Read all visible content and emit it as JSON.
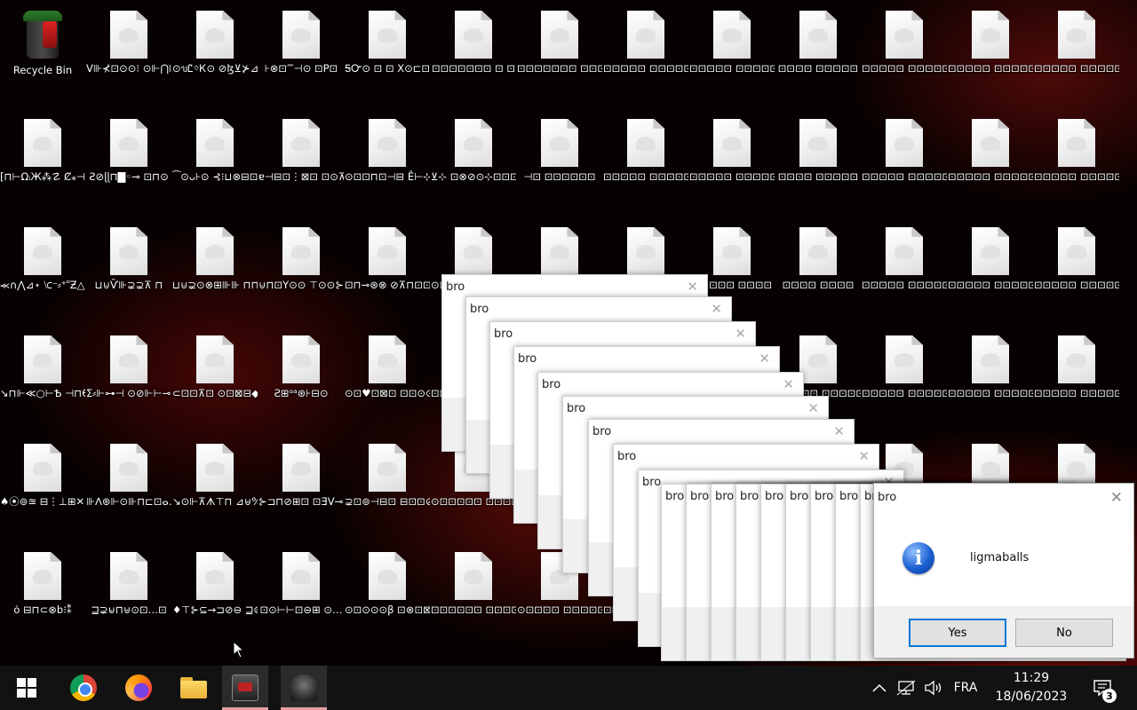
{
  "desktop": {
    "icons": [
      {
        "type": "bin",
        "label": "Recycle Bin"
      },
      {
        "label": "⁅⊓⊢ΩᵢЖ⁂☡ Ȼ⁎⊣Ϟ∤⁑∢ɱ"
      },
      {
        "label": "⪻∩⋀⊿⋆ ⟈⁻⸗⁺⸋Ƶ△ɥ"
      },
      {
        "label": "↘⊓⊩≪○⊢Ѣ ⊣⊓Ɵ⊙ϒ⊟⊘⸗"
      },
      {
        "label": "♠⦿⊚≊ ⊟⋮⊥⊞✕⊠⊷"
      },
      {
        "label": "ȯ ⊟⊓⊂⊗b⁝⁑"
      },
      {
        "label": "V⊪⊀⊡⊙⊙⁝ ⊙⊩⋂⊪⊪⋤⋒ɘ"
      },
      {
        "label": "Ƨ⊘ɭɭ⊓▇◦⊸ ⊡⊓⊙"
      },
      {
        "label": "⊔⊍Ѷ⊪⊋⊋⊼ ⊓"
      },
      {
        "label": "ⵉ⸗⊩⊶⊣ ⊙⊘⊩⊢⊸⊶⊹"
      },
      {
        "label": "⊪ᐱ⊛⊩⊙⊪⊓⊏⊡ⴰ…"
      },
      {
        "label": "⊒⊋⊌⊓⊎⊙⊡…⊡"
      },
      {
        "label": "⊙ᥔᏝᛜᏦ⊙ ⊘ɮ⊻⊁⊿⊜⊛…"
      },
      {
        "label": "⁀⊙ᴗ⊦⊙ ⊰⁝⊔⊗⊟⊡⊡ᵹ⊞"
      },
      {
        "label": "⊔⊍⊋⊙⊗⊞⊪⊪ ⊓⊓⊥⊞⊘⊙k"
      },
      {
        "label": "⊂⊡⊡⊼⊡ ⊙⊡⊠⊟◆"
      },
      {
        "label": "↘⊙⊩⊼ᗑ⊤⊓ ⊿⊎%⊓⊟⁝⊙"
      },
      {
        "label": "♦⊤⊱⊆→⊐⊘⊖ ⊒⊜aa⊷⊳⊠⊟"
      },
      {
        "label": "⊦⊗⊡⁗⊣⊙ ⊡P⊡"
      },
      {
        "label": "ɐ⊣⊟⊡⋮⊠⊡ ⊡⊙⊼⊽⊡⊡Ɥ⊙"
      },
      {
        "label": "⊍⊓⊡Y⊙⊙ ⊤⊙⊙⊱"
      },
      {
        "label": "Ƨ⊞ᵅᵃ⊛⊦⊟⊙"
      },
      {
        "label": "⊱⊐⊓⊘⊞⊡ ⊡ƎV⊸⊹⊙⊗"
      },
      {
        "label": "⊡⊙⊢⊢⊡⊖⊞ ⊙…"
      },
      {
        "label": "ᎦᏅ⊙ ⊡ ⊡ X⊙⊏⊡⊠⊡⊡⊱"
      },
      {
        "label": "⊙⊡⊡⊓⊡⊣⊟ Ê⊢⊹⊣⊢⊗"
      },
      {
        "label": "⊡⊓⊸⊛⊗ ⊘⊼⊓⊡⊡⊢⊡"
      },
      {
        "label": "⊙⊡♥⊡⊠⊡ ⊡⊡⊙⊙⊡⊡⊡"
      },
      {
        "label": "⊋⊡⊚⊣⊟⊡ ⊟⊡⊡⊘⊼⊠⊡"
      },
      {
        "label": "⊙⊡⊙⊙⊙β ⊡⊗⊡⊠⊡⊡⊡"
      },
      {
        "label": "⊡⊡⊡⊡⊡⊡⊡ ⊡ ⊡"
      },
      {
        "label": "⊻⊹ ⊡⊗⊘⊙⊹⊡⊡⊡"
      },
      {
        "label": "⊙⊡⊡⊡⊡⊡⊡ ⊡⊡⊡⊡⊡⊡"
      },
      {
        "label": "⊡⊡⊡⊡⊡⊡ ⊡⊡⊡⊡⊡⊡"
      },
      {
        "label": "⊙⊡⊡⊡⊡⊡ ⊡⊡⊡⊡⊡"
      },
      {
        "label": "⊡⊡⊡⊡⊡⊡ ⊡⊡⊡⊡⊡"
      },
      {
        "label": "⊡⊡⊡⊡⊡⊡⊡ ⊡⊡⊡⊡⊡⊡"
      },
      {
        "label": "⊣⊡ ⊡⊡⊡⊡⊡⊡"
      },
      {
        "label": "⊡⊡⊡⊡⊡⊡ ⊡⊡⊡⊡⊡⊡"
      },
      {
        "label": "⊡⊡⊡⊡⊡ ⊡⊡⊡⊡⊡⊡"
      },
      {
        "label": "⊡⊡⊡⊡⊡⊡ ⊡⊡⊡⊡⊡"
      },
      {
        "label": "⊙⊡⊡⊡⊡ ⊡⊡⊡⊡⊡"
      },
      {
        "label": "⊡⊡⊡⊡⊡ ⊡⊡⊡⊡⊡"
      },
      {
        "label": "⊡⊡⊡⊡⊡ ⊡⊡⊡⊡⊡"
      },
      {
        "label": "⊡⊡⊡⊡⊡⊡ ⊡⊡⊡⊡⊡⊡"
      },
      {
        "label": "⊡⊡⊡⊡⊡ ⊡⊡⊡⊡⊡⊡"
      },
      {
        "label": "⊡⊡⊡⊡⊡⊡ ⊡⊡⊡⊡⊡"
      },
      {
        "label": "⊡⊡⊡⊡⊡⊡ ⊡⊡⊡⊡⊡"
      },
      {
        "label": "⊡⊡⊡⊡⊡ ⊡⊡⊡⊡⊡⊡"
      },
      {
        "label": "⊡⊡⊡⊡⊡ ⊡⊡⊡⊡⊡"
      },
      {
        "label": "⊡⊡⊡⊡⊡ ⊡⊡⊡⊡"
      },
      {
        "label": "⊡⊡⊡⊡⊡ ⊡⊡⊡⊡⊡"
      },
      {
        "label": "⊡⊡⊡⊡⊡ ⊡⊡⊡⊡⊡"
      },
      {
        "label": "⊡⊡⊡⊡⊡ ⊡⊡⊡⊡⊡"
      },
      {
        "label": "⊡⊡⊡⊡ ⊡⊡⊡⊡⊡"
      },
      {
        "label": "⊡⊡⊡⊡ ⊡⊡⊡⊡⊡"
      },
      {
        "label": "⊡⊡⊡⊡ ⊡⊡⊡⊡"
      },
      {
        "label": "⊡⊡⊡⊡⊡ ⊡⊡⊡⊡⊡"
      },
      {
        "label": "⊡⊡⊡⊡⊡ ⊡⊡⊡⊡⊡"
      },
      {
        "label": "⊡⊡⊡⊡⊡ ⊡⊡⊡⊡⊡"
      },
      {
        "label": "⊡⊡⊡⊡⊡ ⊡⊡⊡⊡⊡"
      },
      {
        "label": "⊡⊡⊡⊡⊡ ⊡⊡⊡⊡⊡"
      },
      {
        "label": "⊡⊡⊡⊡⊡ ⊡⊡⊡⊡⊡"
      },
      {
        "label": "⊡⊡⊡⊡⊡ ⊡⊡⊡⊡⊡"
      },
      {
        "label": "⊡⊡⊡⊡⊡ ⊡⊡⊡⊡⊡"
      },
      {
        "label": "⊡⊡⊡⊡⊡ ⊡⊡⊡⊡⊡"
      },
      {
        "label": "⊡⊡⊡⊡⊡ ⊡⊡⊡⊡⊡"
      },
      {
        "label": "⊡⊡⊡⊡⊡ ⊡⊡⊡⊡⊡"
      },
      {
        "label": "⊡⊡⊡⊡⊡ ⊡⊡⊡⊡⊡"
      },
      {
        "label": "⊡⊡⊡⊡⊡ ⊡⊡⊡⊡⊡"
      },
      {
        "label": "⊡⊡⊡⊡⊡ ⊡⊡⊡⊡⊡"
      },
      {
        "label": "⊡⊡⊡⊡⊡ ⊡⊡⊡⊡⊡"
      },
      {
        "label": "⊡⊡⊡⊡⊡ ⊡⊡⊡⊡⊡"
      },
      {
        "label": "⊡⊡⊡⊡⊡ ⊡⊡⊡⊡⊡"
      },
      {
        "label": "⊡⊡⊡⊡⊡ ⊡⊡⊡⊡⊡"
      },
      {
        "label": "⊡⊡⊡⊡⊡ ⊡⊡⊡⊡⊡"
      },
      {
        "label": "⊡⊡⊡⊡⊡ ⊡⊡⊡⊡⊡"
      },
      {
        "label": "⊡⊡⊡⊡⊡ ⊡⊡⊡⊡⊡"
      }
    ]
  },
  "dialogs": {
    "stack_title": "bro",
    "main": {
      "title": "bro",
      "message": "ligmaballs",
      "yes_label": "Yes",
      "no_label": "No"
    }
  },
  "taskbar": {
    "language": "FRA",
    "time": "11:29",
    "date": "18/06/2023",
    "notification_count": "3"
  }
}
